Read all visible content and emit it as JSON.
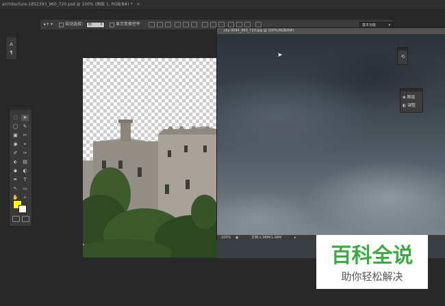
{
  "tab": {
    "title": "architecture-1852393_960_720.psd @ 100% (图层 1, RGB/8#) *",
    "close": "×"
  },
  "options": {
    "auto_select_label": "自动选择：",
    "auto_select_value": "组",
    "show_transform_label": "显示变换控件",
    "workspace": "基本功能"
  },
  "char_panel": {
    "a_label": "A",
    "b_label": "¶"
  },
  "tools": {
    "items": [
      "⬚",
      "➤",
      "◯",
      "✎",
      "▣",
      "✂",
      "◉",
      "⌖",
      "✐",
      "✑",
      "⬖",
      "▤",
      "◆",
      "◐",
      "✒",
      "T",
      "↖",
      "▭",
      "✋",
      "⌕"
    ]
  },
  "colors": {
    "foreground": "#ffff00",
    "background": "#ffffff"
  },
  "sky_window": {
    "title": "sky-3094_960_720.jpg @ 100%(RGB/8#)",
    "zoom": "100%",
    "doc_info": "文档:1.98M/1.98M"
  },
  "panels": {
    "history_label": "历史",
    "layers_label": "图层",
    "adjust_label": "调整"
  },
  "watermark": {
    "big": "百科全说",
    "small": "助你轻松解决"
  }
}
